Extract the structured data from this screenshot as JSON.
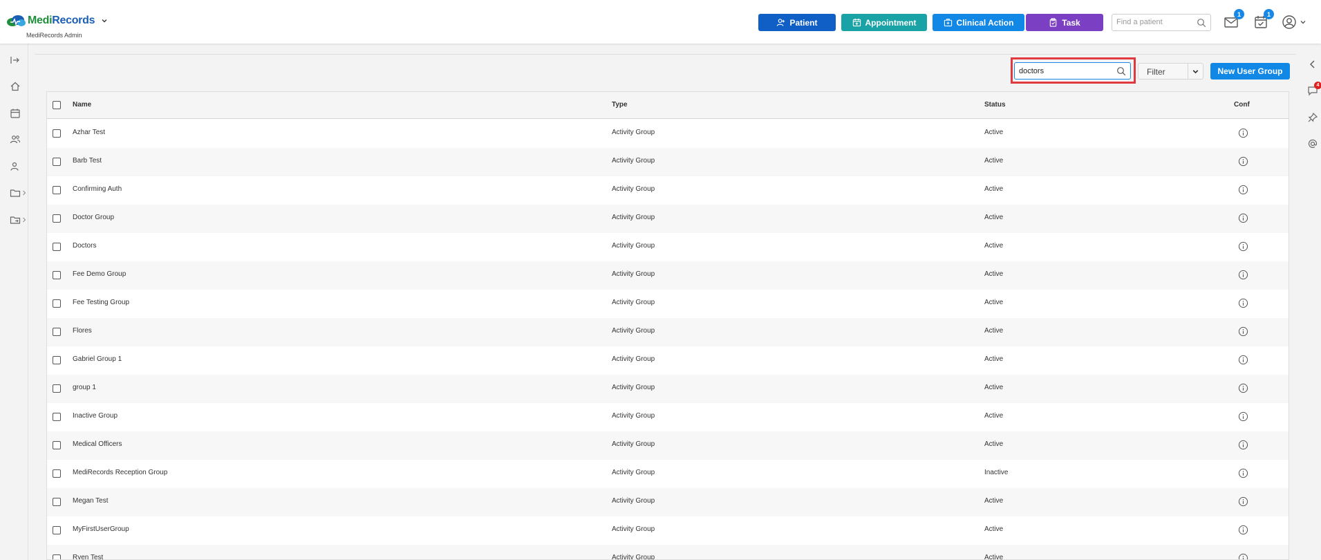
{
  "header": {
    "brand_medi": "Medi",
    "brand_records": "Records",
    "subtitle": "MediRecords Admin",
    "buttons": [
      {
        "label": "Patient",
        "color": "#0f5fc7"
      },
      {
        "label": "Appointment",
        "color": "#1aa3a7"
      },
      {
        "label": "Clinical Action",
        "color": "#1187e6"
      },
      {
        "label": "Task",
        "color": "#7b3fc4"
      }
    ],
    "search_placeholder": "Find a patient",
    "mail_badge": "1",
    "tasks_badge": "1"
  },
  "left_nav": {
    "icons": [
      "collapse-icon",
      "home-icon",
      "calendar-icon",
      "users-icon",
      "user-icon",
      "folder-icon",
      "folder-share-icon"
    ]
  },
  "right_panel": {
    "chat_badge": "4",
    "icons": [
      "chevron-left-icon",
      "chat-icon",
      "pin-icon",
      "at-icon"
    ]
  },
  "toolbar": {
    "search_value": "doctors",
    "filter_label": "Filter",
    "new_button_label": "New User Group"
  },
  "table": {
    "columns": [
      "Name",
      "Type",
      "Status",
      "Conf"
    ],
    "rows": [
      {
        "name": "Azhar Test",
        "type": "Activity Group",
        "status": "Active"
      },
      {
        "name": "Barb Test",
        "type": "Activity Group",
        "status": "Active"
      },
      {
        "name": "Confirming Auth",
        "type": "Activity Group",
        "status": "Active"
      },
      {
        "name": "Doctor Group",
        "type": "Activity Group",
        "status": "Active"
      },
      {
        "name": "Doctors",
        "type": "Activity Group",
        "status": "Active"
      },
      {
        "name": "Fee Demo Group",
        "type": "Activity Group",
        "status": "Active"
      },
      {
        "name": "Fee Testing Group",
        "type": "Activity Group",
        "status": "Active"
      },
      {
        "name": "Flores",
        "type": "Activity Group",
        "status": "Active"
      },
      {
        "name": "Gabriel Group 1",
        "type": "Activity Group",
        "status": "Active"
      },
      {
        "name": "group 1",
        "type": "Activity Group",
        "status": "Active"
      },
      {
        "name": "Inactive Group",
        "type": "Activity Group",
        "status": "Active"
      },
      {
        "name": "Medical Officers",
        "type": "Activity Group",
        "status": "Active"
      },
      {
        "name": "MediRecords Reception Group",
        "type": "Activity Group",
        "status": "Inactive"
      },
      {
        "name": "Megan Test",
        "type": "Activity Group",
        "status": "Active"
      },
      {
        "name": "MyFirstUserGroup",
        "type": "Activity Group",
        "status": "Active"
      },
      {
        "name": "Ryen Test",
        "type": "Activity Group",
        "status": "Active"
      }
    ]
  },
  "highlight_color": "#e0393f"
}
